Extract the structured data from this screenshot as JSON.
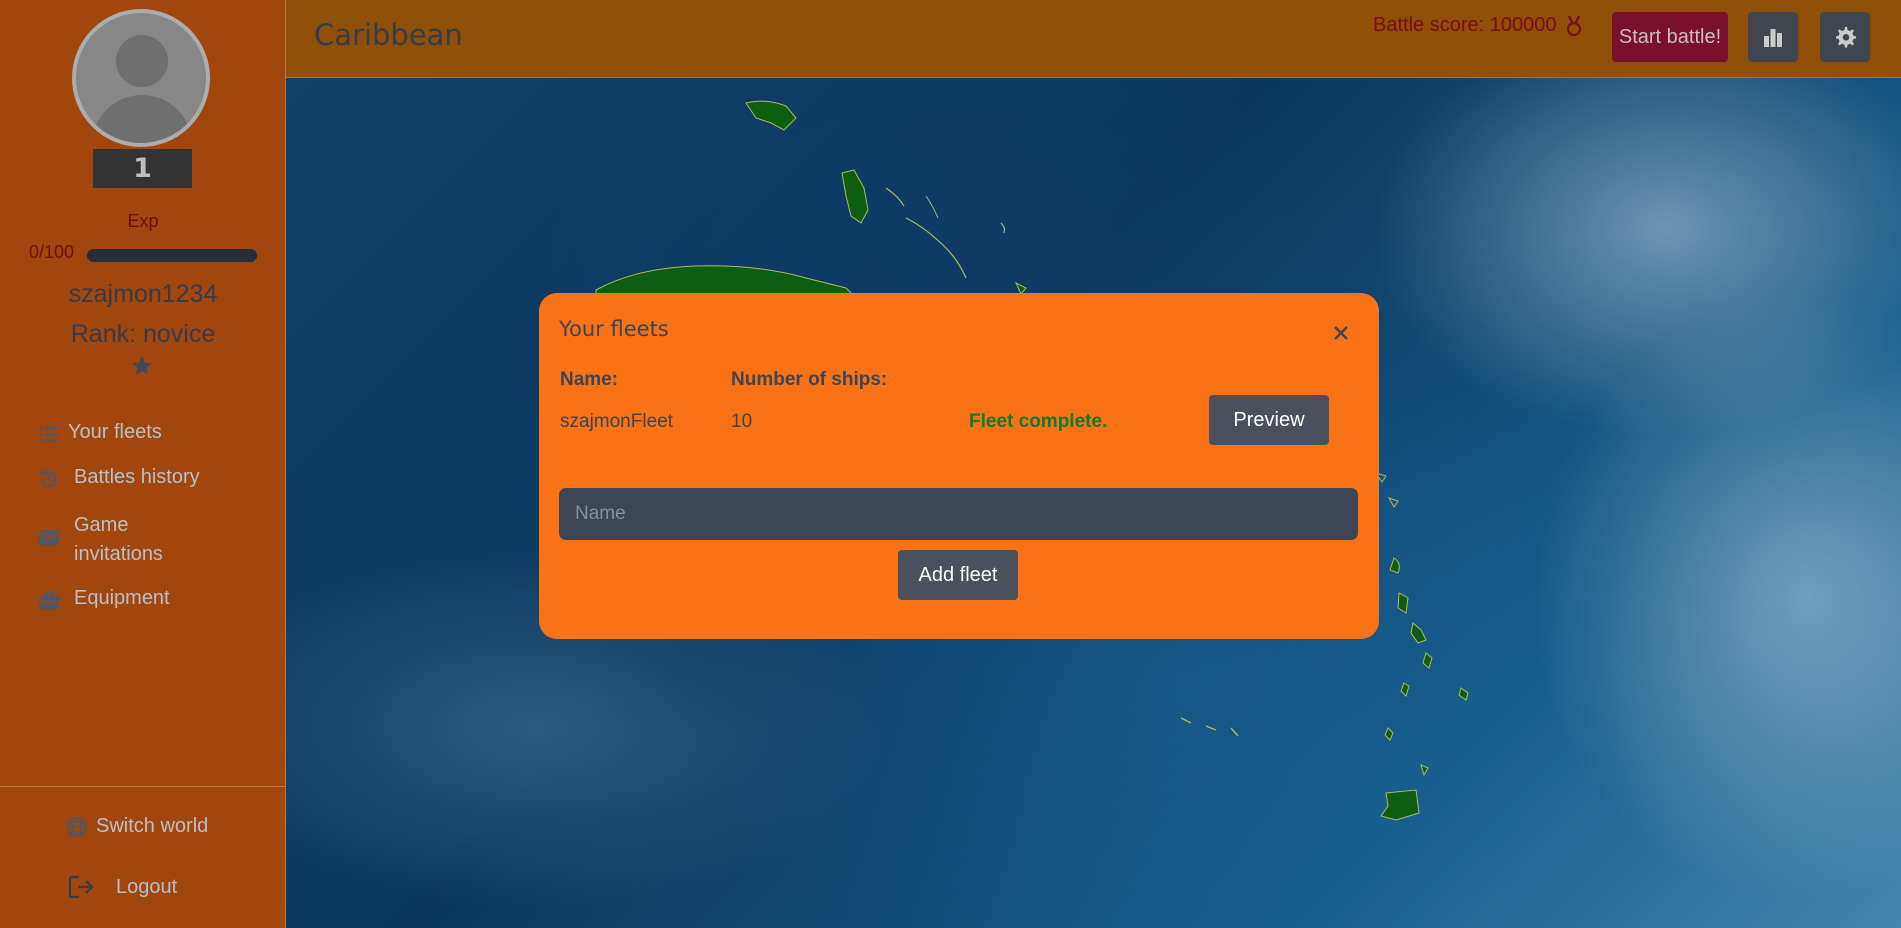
{
  "sidebar": {
    "level": "1",
    "exp_label": "Exp",
    "exp_value": "0/100",
    "exp_fraction": 0,
    "username": "szajmon1234",
    "rank": "Rank: novice",
    "nav": [
      {
        "label": "Your fleets",
        "icon": "list-icon"
      },
      {
        "label": "Battles history",
        "icon": "history-icon"
      },
      {
        "label": "Game invitations",
        "icon": "envelope-icon"
      },
      {
        "label": "Equipment",
        "icon": "briefcase-icon"
      }
    ],
    "switch_world": "Switch world",
    "logout": "Logout"
  },
  "header": {
    "world_title": "Caribbean",
    "battle_score": "Battle score: 100000",
    "start_battle": "Start battle!"
  },
  "modal": {
    "title": "Your fleets",
    "columns": [
      "Name:",
      "Number of ships:"
    ],
    "fleets": [
      {
        "name": "szajmonFleet",
        "ships": "10",
        "status": "Fleet complete.",
        "action": "Preview"
      }
    ],
    "name_placeholder": "Name",
    "add_fleet": "Add fleet"
  },
  "colors": {
    "sidebar_bg": "#b8500f",
    "topbar_bg": "#a35a07",
    "modal_bg": "#f97316",
    "start_battle_bg": "#8c1235",
    "button_bg": "#4a505c",
    "status_ok": "#117a2e",
    "score_text": "#8a1020"
  }
}
